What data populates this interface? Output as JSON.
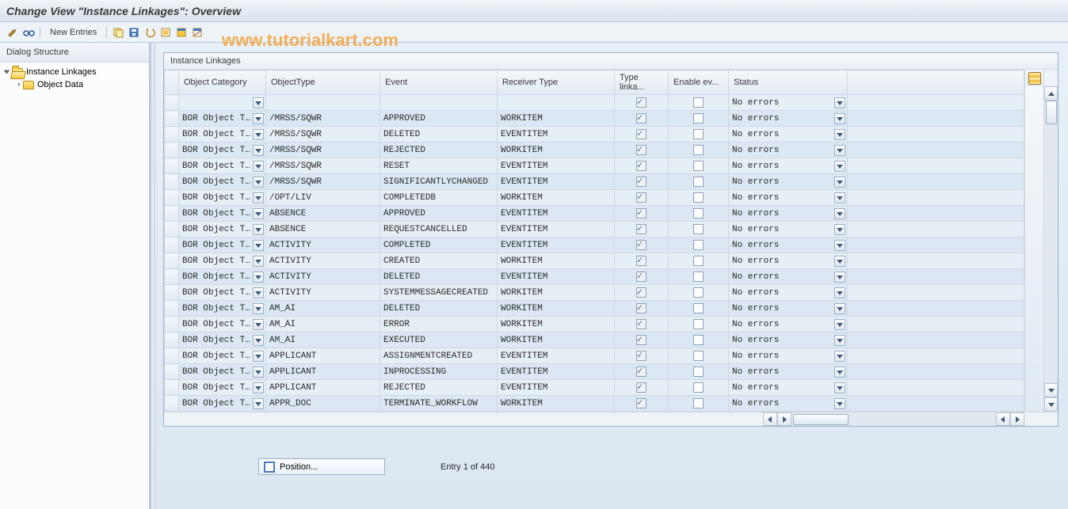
{
  "title": "Change View \"Instance Linkages\": Overview",
  "watermark": "www.tutorialkart.com",
  "toolbar": {
    "new_entries": "New Entries"
  },
  "left": {
    "header": "Dialog Structure",
    "node1": "Instance Linkages",
    "node2": "Object Data"
  },
  "grid": {
    "title": "Instance Linkages",
    "headers": {
      "cat": "Object Category",
      "type": "ObjectType",
      "event": "Event",
      "recv": "Receiver Type",
      "chk1": "Type linka...",
      "chk2": "Enable ev...",
      "status": "Status"
    },
    "status_value": "No errors",
    "cat_value": "BOR Object T…",
    "rows": [
      {
        "cat": "",
        "type": "",
        "event": "",
        "recv": "",
        "c1": true,
        "c2": false
      },
      {
        "cat": "BOR Object T…",
        "type": "/MRSS/SQWR",
        "event": "APPROVED",
        "recv": "WORKITEM",
        "c1": true,
        "c2": false
      },
      {
        "cat": "BOR Object T…",
        "type": "/MRSS/SQWR",
        "event": "DELETED",
        "recv": "EVENTITEM",
        "c1": true,
        "c2": false
      },
      {
        "cat": "BOR Object T…",
        "type": "/MRSS/SQWR",
        "event": "REJECTED",
        "recv": "WORKITEM",
        "c1": true,
        "c2": false
      },
      {
        "cat": "BOR Object T…",
        "type": "/MRSS/SQWR",
        "event": "RESET",
        "recv": "EVENTITEM",
        "c1": true,
        "c2": false
      },
      {
        "cat": "BOR Object T…",
        "type": "/MRSS/SQWR",
        "event": "SIGNIFICANTLYCHANGED",
        "recv": "EVENTITEM",
        "c1": true,
        "c2": false
      },
      {
        "cat": "BOR Object T…",
        "type": "/OPT/LIV",
        "event": "COMPLETEDB",
        "recv": "WORKITEM",
        "c1": true,
        "c2": false
      },
      {
        "cat": "BOR Object T…",
        "type": "ABSENCE",
        "event": "APPROVED",
        "recv": "EVENTITEM",
        "c1": true,
        "c2": false
      },
      {
        "cat": "BOR Object T…",
        "type": "ABSENCE",
        "event": "REQUESTCANCELLED",
        "recv": "EVENTITEM",
        "c1": true,
        "c2": false
      },
      {
        "cat": "BOR Object T…",
        "type": "ACTIVITY",
        "event": "COMPLETED",
        "recv": "EVENTITEM",
        "c1": true,
        "c2": false
      },
      {
        "cat": "BOR Object T…",
        "type": "ACTIVITY",
        "event": "CREATED",
        "recv": "WORKITEM",
        "c1": true,
        "c2": false
      },
      {
        "cat": "BOR Object T…",
        "type": "ACTIVITY",
        "event": "DELETED",
        "recv": "EVENTITEM",
        "c1": true,
        "c2": false
      },
      {
        "cat": "BOR Object T…",
        "type": "ACTIVITY",
        "event": "SYSTEMMESSAGECREATED",
        "recv": "WORKITEM",
        "c1": true,
        "c2": false
      },
      {
        "cat": "BOR Object T…",
        "type": "AM_AI",
        "event": "DELETED",
        "recv": "WORKITEM",
        "c1": true,
        "c2": false
      },
      {
        "cat": "BOR Object T…",
        "type": "AM_AI",
        "event": "ERROR",
        "recv": "WORKITEM",
        "c1": true,
        "c2": false
      },
      {
        "cat": "BOR Object T…",
        "type": "AM_AI",
        "event": "EXECUTED",
        "recv": "WORKITEM",
        "c1": true,
        "c2": false
      },
      {
        "cat": "BOR Object T…",
        "type": "APPLICANT",
        "event": "ASSIGNMENTCREATED",
        "recv": "EVENTITEM",
        "c1": true,
        "c2": false
      },
      {
        "cat": "BOR Object T…",
        "type": "APPLICANT",
        "event": "INPROCESSING",
        "recv": "EVENTITEM",
        "c1": true,
        "c2": false
      },
      {
        "cat": "BOR Object T…",
        "type": "APPLICANT",
        "event": "REJECTED",
        "recv": "EVENTITEM",
        "c1": true,
        "c2": false
      },
      {
        "cat": "BOR Object T…",
        "type": "APPR_DOC",
        "event": "TERMINATE_WORKFLOW",
        "recv": "WORKITEM",
        "c1": true,
        "c2": false
      }
    ]
  },
  "footer": {
    "position": "Position...",
    "entry": "Entry 1 of 440"
  }
}
